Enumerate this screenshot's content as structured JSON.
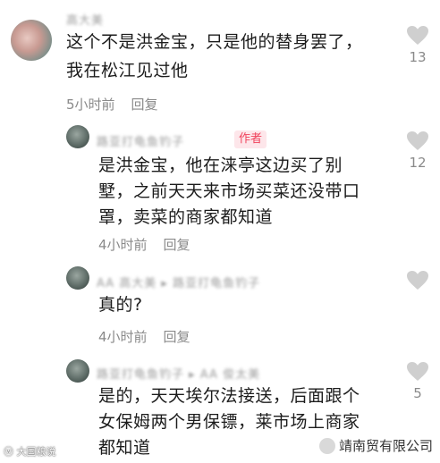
{
  "comments": [
    {
      "username": "高大美",
      "text": "这个不是洪金宝，只是他的替身罢了，我在松江见过他",
      "line1": "这个不是洪金宝，只是他的替身罢了，",
      "line2": "我在松江见过他",
      "time": "5小时前",
      "reply_label": "回复",
      "likes": "13"
    },
    {
      "username": "路亚打龟鱼钓子",
      "badge": "作者",
      "line1": "是洪金宝，他在涞亭这边买了别",
      "line2": "墅，之前天天来市场买菜还没带口",
      "line3": "罩，卖菜的商家都知道",
      "time": "4小时前",
      "reply_label": "回复",
      "likes": "12"
    },
    {
      "username": "AA 高大美 ▸ 路亚打龟鱼钓子",
      "line1": "真的?",
      "time": "4小时前",
      "reply_label": "回复",
      "likes": ""
    },
    {
      "username": "路亚打龟鱼钓子 ▸ AA 俊太美",
      "line1": "是的，天天埃尔法接送，后面跟个",
      "line2": "女保姆两个男保镖，莱市场上商家",
      "line3": "都知道",
      "likes": "5"
    }
  ],
  "watermark": {
    "left": "ⓦ 大国粮说",
    "right": "靖南贸有限公司"
  },
  "colors": {
    "heart": "#cfcfcf",
    "badge_bg": "#fde6ea",
    "badge_text": "#f0435c"
  },
  "icons": {
    "like": "heart-icon",
    "watermark": "wechat-icon"
  }
}
